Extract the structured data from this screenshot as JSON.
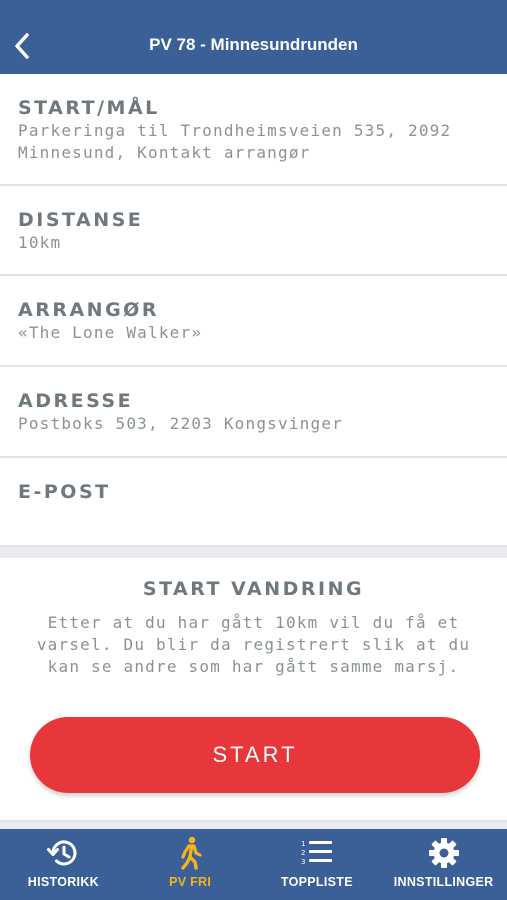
{
  "header": {
    "title": "PV 78 - Minnesundrunden",
    "back_icon": "chevron-left-icon"
  },
  "info": [
    {
      "label": "START/MÅL",
      "value": "Parkeringa til Trondheimsveien 535, 2092 Minnesund, Kontakt arrangør"
    },
    {
      "label": "DISTANSE",
      "value": "10km"
    },
    {
      "label": "ARRANGØR",
      "value": "«The Lone Walker»"
    },
    {
      "label": "ADRESSE",
      "value": "Postboks 503, 2203 Kongsvinger"
    },
    {
      "label": "E-POST",
      "value": ""
    }
  ],
  "start_panel": {
    "heading": "START VANDRING",
    "text": "Etter at du har gått 10km vil du få et varsel. Du blir da registrert slik at du kan se andre som har gått samme marsj.",
    "button_label": "START"
  },
  "tabs": [
    {
      "label": "HISTORIKK",
      "icon": "history-icon",
      "active": false
    },
    {
      "label": "PV FRI",
      "icon": "walking-icon",
      "active": true
    },
    {
      "label": "TOPPLISTE",
      "icon": "ranked-list-icon",
      "active": false
    },
    {
      "label": "INNSTILLINGER",
      "icon": "gear-icon",
      "active": false
    }
  ],
  "colors": {
    "header_bg": "#3a6097",
    "start_button": "#e8373a",
    "active_tab": "#f3b51b"
  }
}
